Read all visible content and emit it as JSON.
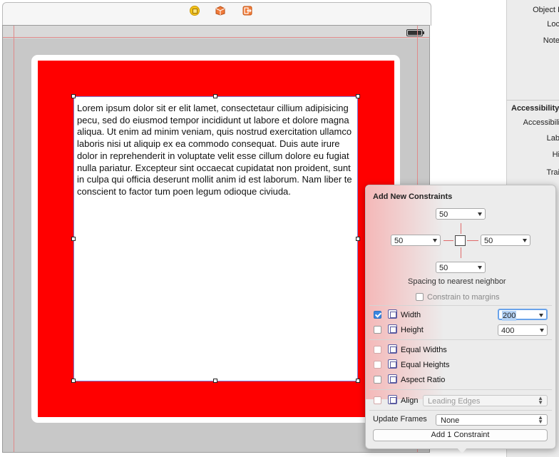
{
  "canvas": {
    "lorem_text": "Lorem ipsum dolor sit er elit lamet, consectetaur cillium adipisicing pecu, sed do eiusmod tempor incididunt ut labore et dolore magna aliqua. Ut enim ad minim veniam, quis nostrud exercitation ullamco laboris nisi ut aliquip ex ea commodo consequat. Duis aute irure dolor in reprehenderit in voluptate velit esse cillum dolore eu fugiat nulla pariatur. Excepteur sint occaecat cupidatat non proident, sunt in culpa qui officia deserunt mollit anim id est laborum. Nam liber te conscient to factor tum poen legum odioque civiuda.",
    "colors": {
      "red_view": "#ff0000",
      "white_view": "#ffffff",
      "canvas_bg": "#c8c8c8"
    }
  },
  "scene_bar": {
    "icons": [
      "view-controller-icon",
      "first-responder-icon",
      "exit-icon"
    ]
  },
  "inspector": {
    "labels": [
      "Object I",
      "Loc",
      "Note",
      "Accessibility",
      "Accessibili",
      "Lab",
      "Hi",
      "Trai"
    ]
  },
  "popover": {
    "title": "Add New Constraints",
    "top_value": "50",
    "left_value": "50",
    "right_value": "50",
    "bottom_value": "50",
    "spacing_label": "Spacing to nearest neighbor",
    "constrain_margins_label": "Constrain to margins",
    "constrain_margins_checked": false,
    "width": {
      "label": "Width",
      "checked": true,
      "value": "200"
    },
    "height": {
      "label": "Height",
      "checked": false,
      "value": "400"
    },
    "equal_widths": {
      "label": "Equal Widths",
      "checked": false
    },
    "equal_heights": {
      "label": "Equal Heights",
      "checked": false
    },
    "aspect_ratio": {
      "label": "Aspect Ratio",
      "checked": false
    },
    "align": {
      "label": "Align",
      "checked": false,
      "value": "Leading Edges"
    },
    "update_frames_label": "Update Frames",
    "update_frames_value": "None",
    "add_button_label": "Add 1 Constraint",
    "accent_color": "#3a86e0"
  }
}
